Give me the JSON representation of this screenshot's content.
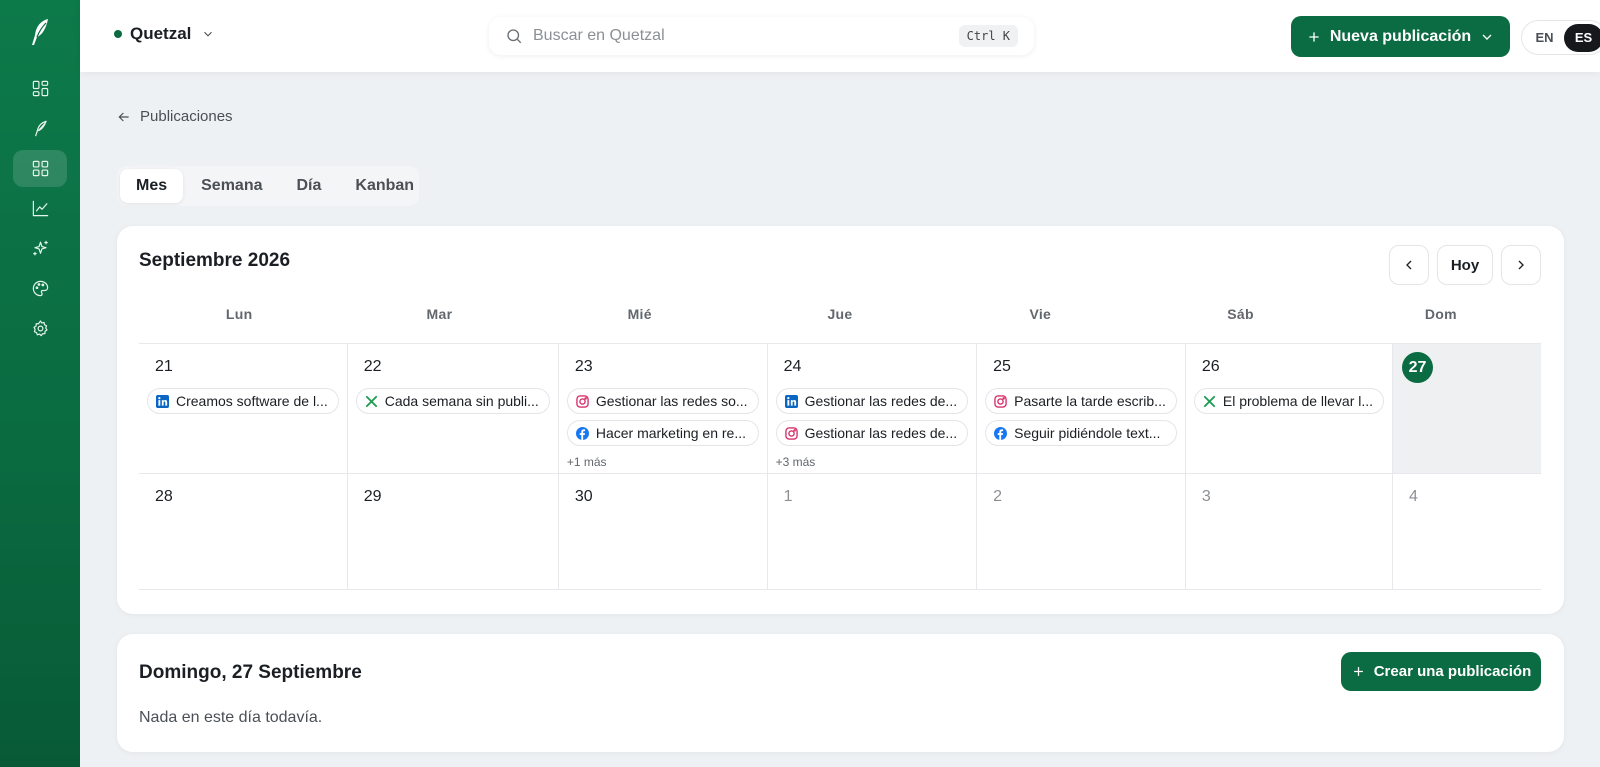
{
  "app": {
    "workspace": "Quetzal",
    "accent": "#0b6b42"
  },
  "search": {
    "placeholder": "Buscar en Quetzal",
    "value": "",
    "shortcut": "Ctrl K"
  },
  "header": {
    "new_post_label": "Nueva publicación",
    "lang_en": "EN",
    "lang_es": "ES",
    "active_lang": "ES"
  },
  "sidebar": {
    "items": [
      {
        "icon": "dashboard-icon",
        "active": false
      },
      {
        "icon": "quill-icon",
        "active": false
      },
      {
        "icon": "grid-icon",
        "active": true
      },
      {
        "icon": "analytics-icon",
        "active": false
      },
      {
        "icon": "sparkles-icon",
        "active": false
      },
      {
        "icon": "palette-icon",
        "active": false
      },
      {
        "icon": "gear-icon",
        "active": false
      }
    ]
  },
  "breadcrumb": {
    "back_label": "Publicaciones"
  },
  "tabs": [
    {
      "label": "Mes",
      "active": true
    },
    {
      "label": "Semana",
      "active": false
    },
    {
      "label": "Día",
      "active": false
    },
    {
      "label": "Kanban",
      "active": false
    }
  ],
  "calendar": {
    "title": "Septiembre 2026",
    "today_label": "Hoy",
    "weekdays": [
      "Lun",
      "Mar",
      "Mié",
      "Jue",
      "Vie",
      "Sáb",
      "Dom"
    ],
    "days": [
      {
        "num": "21",
        "muted": false,
        "today": false,
        "posts": [
          {
            "platform": "linkedin",
            "text": "Creamos software de l..."
          }
        ],
        "more": ""
      },
      {
        "num": "22",
        "muted": false,
        "today": false,
        "posts": [
          {
            "platform": "x",
            "text": "Cada semana sin publi..."
          }
        ],
        "more": ""
      },
      {
        "num": "23",
        "muted": false,
        "today": false,
        "posts": [
          {
            "platform": "instagram",
            "text": "Gestionar las redes so..."
          },
          {
            "platform": "facebook",
            "text": "Hacer marketing en re..."
          }
        ],
        "more": "+1 más"
      },
      {
        "num": "24",
        "muted": false,
        "today": false,
        "posts": [
          {
            "platform": "linkedin",
            "text": "Gestionar las redes de..."
          },
          {
            "platform": "instagram",
            "text": "Gestionar las redes de..."
          }
        ],
        "more": "+3 más"
      },
      {
        "num": "25",
        "muted": false,
        "today": false,
        "posts": [
          {
            "platform": "instagram",
            "text": "Pasarte la tarde escrib..."
          },
          {
            "platform": "facebook",
            "text": "Seguir pidiéndole text..."
          }
        ],
        "more": ""
      },
      {
        "num": "26",
        "muted": false,
        "today": false,
        "posts": [
          {
            "platform": "x",
            "text": "El problema de llevar l..."
          }
        ],
        "more": ""
      },
      {
        "num": "27",
        "muted": false,
        "today": true,
        "posts": [],
        "more": ""
      },
      {
        "num": "28",
        "muted": false,
        "today": false,
        "posts": [],
        "more": ""
      },
      {
        "num": "29",
        "muted": false,
        "today": false,
        "posts": [],
        "more": ""
      },
      {
        "num": "30",
        "muted": false,
        "today": false,
        "posts": [],
        "more": ""
      },
      {
        "num": "1",
        "muted": true,
        "today": false,
        "posts": [],
        "more": ""
      },
      {
        "num": "2",
        "muted": true,
        "today": false,
        "posts": [],
        "more": ""
      },
      {
        "num": "3",
        "muted": true,
        "today": false,
        "posts": [],
        "more": ""
      },
      {
        "num": "4",
        "muted": true,
        "today": false,
        "posts": [],
        "more": ""
      }
    ]
  },
  "day_panel": {
    "title": "Domingo, 27 Septiembre",
    "empty_text": "Nada en este día todavía.",
    "create_label": "Crear una publicación"
  },
  "platform_colors": {
    "linkedin": "#0a66c2",
    "x": "#1f9d55",
    "instagram": "#d6336c",
    "facebook": "#1877f2"
  }
}
